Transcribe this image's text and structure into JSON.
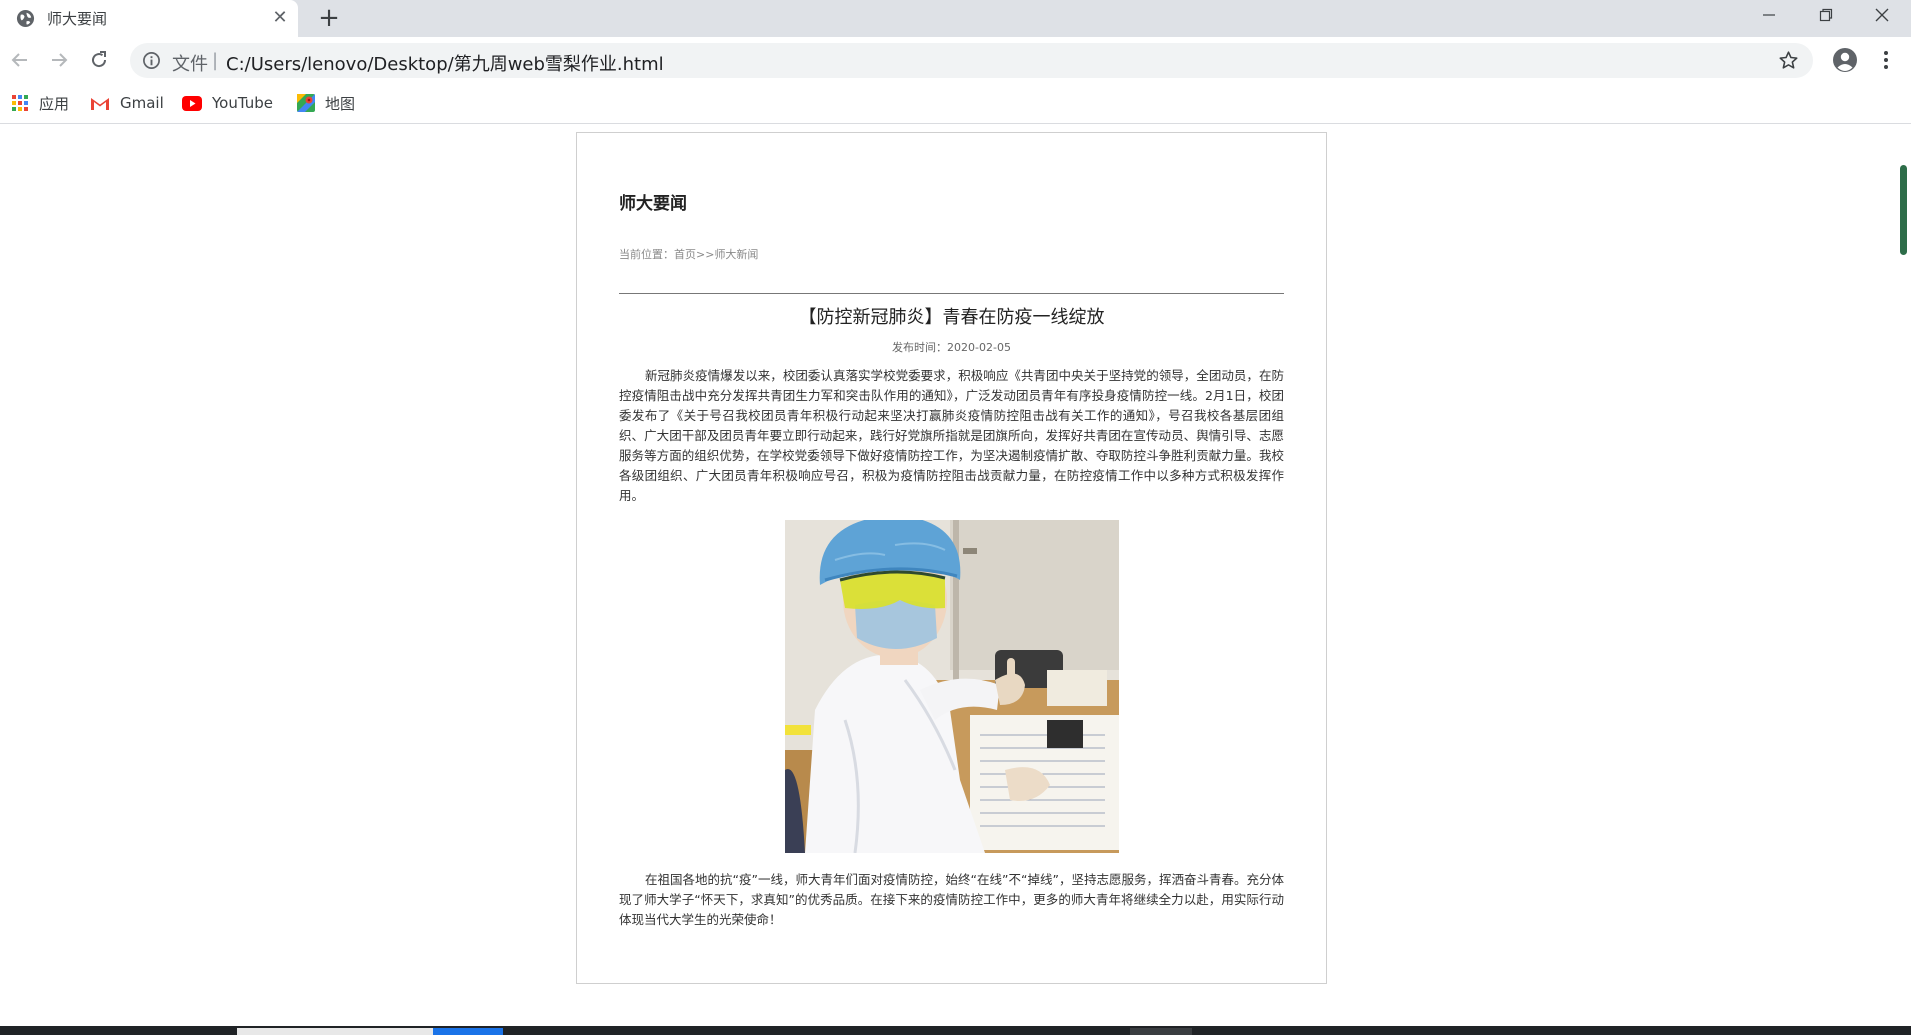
{
  "browser": {
    "tab": {
      "title": "师大要闻",
      "favicon": "globe-icon"
    },
    "address": {
      "scheme_label": "文件",
      "separator": "|",
      "url": "C:/Users/lenovo/Desktop/第九周web雪梨作业.html"
    },
    "bookmarks": [
      {
        "label": "应用",
        "icon": "apps-grid-icon"
      },
      {
        "label": "Gmail",
        "icon": "gmail-icon"
      },
      {
        "label": "YouTube",
        "icon": "youtube-icon"
      },
      {
        "label": "地图",
        "icon": "maps-icon"
      }
    ]
  },
  "page": {
    "site_title": "师大要闻",
    "breadcrumb": {
      "prefix": "当前位置：",
      "home": "首页",
      "sep": ">>",
      "current": "师大新闻"
    },
    "article": {
      "title": "【防控新冠肺炎】青春在防疫一线绽放",
      "date_label": "发布时间：",
      "date": "2020-02-05",
      "para1": "新冠肺炎疫情爆发以来，校团委认真落实学校党委要求，积极响应《共青团中央关于坚持党的领导，全团动员，在防控疫情阻击战中充分发挥共青团生力军和突击队作用的通知》，广泛发动团员青年有序投身疫情防控一线。2月1日，校团委发布了《关于号召我校团员青年积极行动起来坚决打赢肺炎疫情防控阻击战有关工作的通知》，号召我校各基层团组织、广大团干部及团员青年要立即行动起来，践行好党旗所指就是团旗所向，发挥好共青团在宣传动员、舆情引导、志愿服务等方面的组织优势，在学校党委领导下做好疫情防控工作，为坚决遏制疫情扩散、夺取防控斗争胜利贡献力量。我校各级团组织、广大团员青年积极响应号召，积极为疫情防控阻击战贡献力量，在防控疫情工作中以多种方式积极发挥作用。",
      "para2": "在祖国各地的抗“疫”一线，师大青年们面对疫情防控，始终“在线”不“掉线”，坚持志愿服务，挥洒奋斗青春。充分体现了师大学子“怀天下，求真知”的优秀品质。在接下来的疫情防控工作中，更多的师大青年将继续全力以赴，用实际行动体现当代大学生的光荣使命！"
    }
  },
  "colors": {
    "accent_blue": "#1a73e8",
    "scroll_green": "#2d6d49"
  }
}
